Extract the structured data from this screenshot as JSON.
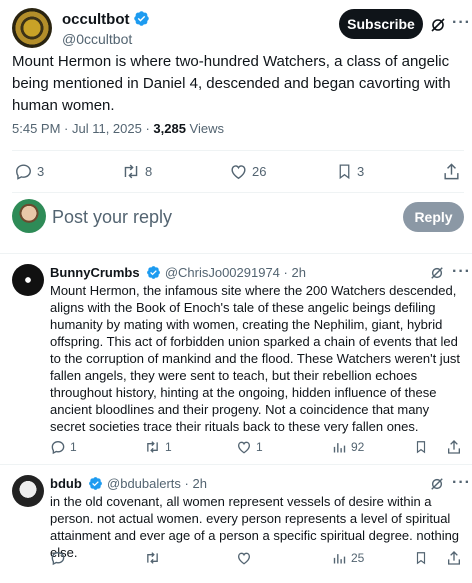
{
  "post": {
    "author_name": "occultbot",
    "author_handle": "@0ccultbot",
    "subscribe_label": "Subscribe",
    "text": "Mount Hermon is where two-hundred Watchers, a class of angelic being mentioned in Daniel 4, descended and began cavorting with human women.",
    "time": "5:45 PM · Jul 11, 2025 · ",
    "views_count": "3,285",
    "views_label": " Views",
    "stats": {
      "replies": "3",
      "reposts": "8",
      "likes": "26",
      "bookmarks": "3"
    }
  },
  "compose": {
    "placeholder": "Post your reply",
    "reply_label": "Reply"
  },
  "replies": [
    {
      "name": "BunnyCrumbs",
      "handle": "@ChrisJo00291974 · 2h",
      "text": "Mount Hermon, the infamous site where the 200 Watchers descended, aligns with the Book of Enoch's tale of these angelic beings defiling humanity by mating with women, creating the Nephilim, giant, hybrid offspring. This act of forbidden union sparked a chain of events that led to the corruption of mankind and the flood. These Watchers weren't just fallen angels, they were sent to teach, but their rebellion echoes throughout history, hinting at the ongoing, hidden influence of these ancient bloodlines and their progeny. Not a coincidence that many secret societies trace their rituals back to these very fallen ones.",
      "stats": {
        "replies": "1",
        "reposts": "1",
        "likes": "1",
        "views": "92"
      }
    },
    {
      "name": "bdub",
      "handle": "@bdubalerts · 2h",
      "text": "in the old covenant, all women represent vessels of desire within a person. not actual women. every person represents a level of spiritual attainment and ever age of a person a specific spiritual degree.  nothing else.",
      "stats": {
        "replies": "",
        "reposts": "",
        "likes": "",
        "views": "25"
      }
    }
  ],
  "colors": {
    "verified": "#1d9bf0",
    "muted": "#536471",
    "text": "#0f1419",
    "subscribe_bg": "#0f1419",
    "reply_btn_bg": "#8b98a5"
  },
  "icons": [
    "verified-badge-icon",
    "grok-icon",
    "more-icon",
    "reply-icon",
    "repost-icon",
    "like-icon",
    "bookmark-icon",
    "share-icon",
    "views-icon"
  ]
}
